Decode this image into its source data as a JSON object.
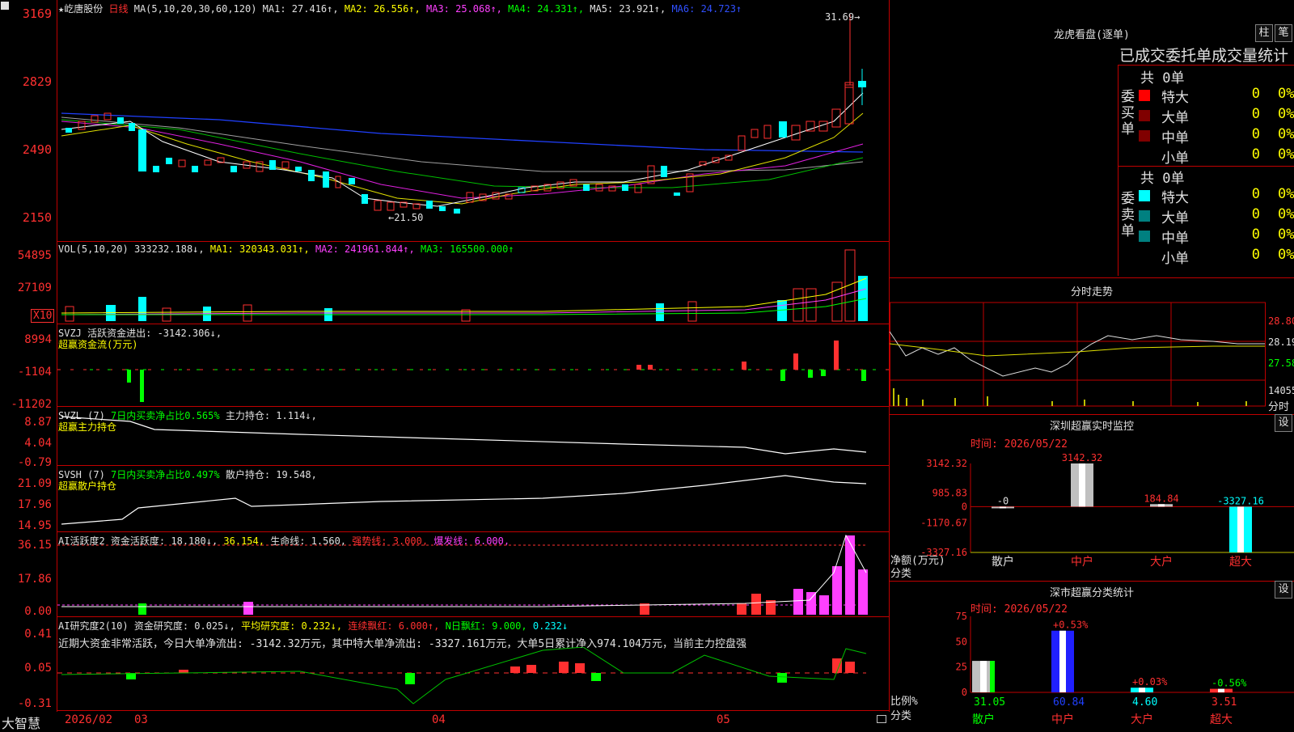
{
  "header": {
    "stock_name": "★屹唐股份",
    "period": "日线",
    "ma_label": "MA(5,10,20,30,60,120)",
    "ma1": "MA1: 27.416↑,",
    "ma2": "MA2: 26.556↑,",
    "ma3": "MA3: 25.068↑,",
    "ma4": "MA4: 24.331↑,",
    "ma5": "MA5: 23.921↑,",
    "ma6": "MA6: 24.723↑"
  },
  "price_axis": [
    "3169",
    "2829",
    "2490",
    "2150"
  ],
  "annotations": {
    "high": "31.69→",
    "low": "←21.50"
  },
  "vol": {
    "label": "VOL(5,10,20)",
    "value": "333232.188↓,",
    "ma1": "MA1: 320343.031↑,",
    "ma2": "MA2: 241961.844↑,",
    "ma3": "MA3: 165500.000↑",
    "axis": [
      "54895",
      "27109"
    ],
    "unit": "X10"
  },
  "svzj": {
    "label": "SVZJ  活跃资金进出: -3142.306↓,",
    "sub": "超赢资金流(万元)",
    "axis": [
      "8994",
      "-1104",
      "-11202"
    ]
  },
  "svzl": {
    "label": "SVZL (7)",
    "ratio": "7日内买卖净占比0.565%",
    "hold": "主力持仓: 1.114↓,",
    "sub": "超赢主力持仓",
    "axis": [
      "8.87",
      "4.04",
      "-0.79"
    ]
  },
  "svsh": {
    "label": "SVSH (7)",
    "ratio": "7日内买卖净占比0.497%",
    "hold": "散户持仓: 19.548,",
    "sub": "超赢散户持仓",
    "axis": [
      "21.09",
      "17.96",
      "14.95"
    ]
  },
  "ai1": {
    "label": "AI活跃度2",
    "v1": "资金活跃度: 18.180↓,",
    "v2": "36.154,",
    "v3": "生命线: 1.560,",
    "v4": "强势线: 3.000,",
    "v5": "爆发线: 6.000,",
    "axis": [
      "36.15",
      "17.86",
      "0.00"
    ]
  },
  "ai2": {
    "label": "AI研究度2(10)",
    "v1": "资金研究度: 0.025↓,",
    "v2": "平均研究度: 0.232↓,",
    "v3": "连续飘红: 6.000↑,",
    "v4": "N日飘红: 9.000,",
    "v5": "0.232↓",
    "comment": "近期大资金非常活跃，今日大单净流出: -3142.32万元，其中特大单净流出: -3327.161万元，大单5日累计净入974.104万元，当前主力控盘强",
    "axis": [
      "0.41",
      "0.05",
      "-0.31"
    ]
  },
  "bottom_axis": {
    "brand": "大智慧",
    "d1": "2026/02",
    "d2": "03",
    "d3": "04",
    "d4": "05"
  },
  "right": {
    "lhb_title": "龙虎看盘(逐单)",
    "btn_bar": "柱",
    "btn_pen": "笔",
    "stats_title": "已成交委托单成交量统计",
    "buy_side": "委买单",
    "sell_side": "委卖单",
    "buy_total": "共 0单",
    "sell_total": "共 0单",
    "buy_rows": [
      {
        "label": "特大",
        "value": "0",
        "pct": "0%",
        "color": "#ff0000"
      },
      {
        "label": "大单",
        "value": "0",
        "pct": "0%",
        "color": "#800000"
      },
      {
        "label": "中单",
        "value": "0",
        "pct": "0%",
        "color": "#800000"
      },
      {
        "label": "小单",
        "value": "0",
        "pct": "0%",
        "color": "#000000"
      }
    ],
    "sell_rows": [
      {
        "label": "特大",
        "value": "0",
        "pct": "0%",
        "color": "#00ffff"
      },
      {
        "label": "大单",
        "value": "0",
        "pct": "0%",
        "color": "#008080"
      },
      {
        "label": "中单",
        "value": "0",
        "pct": "0%",
        "color": "#008080"
      },
      {
        "label": "小单",
        "value": "0",
        "pct": "0%",
        "color": "#000000"
      }
    ],
    "fenshi_title": "分时走势",
    "fenshi_axis": [
      "28.80",
      "28.19",
      "27.58",
      "14055"
    ],
    "fenshi_unit": "分时",
    "sz_monitor_title": "深圳超赢实时监控",
    "sz_monitor_btn": "设",
    "sz_time": "时间: 2026/05/22",
    "net_axis": [
      "3142.32",
      "985.83",
      "0",
      "-1170.67",
      "-3327.16"
    ],
    "net_labels": [
      "-0",
      "3142.32",
      "184.84",
      "-3327.16"
    ],
    "net_unit": "净额(万元)",
    "net_cat": "分类",
    "categories": [
      "散户",
      "中户",
      "大户",
      "超大"
    ],
    "sz_class_title": "深市超赢分类统计",
    "sz_class_btn": "设",
    "class_time": "时间: 2026/05/22",
    "class_axis": [
      "75",
      "50",
      "25",
      "0"
    ],
    "class_top": [
      "+0.53%",
      "+0.03%",
      "-0.56%"
    ],
    "class_values": [
      "31.05",
      "60.84",
      "4.60",
      "3.51"
    ],
    "class_unit": "比例%",
    "class_cat": "分类"
  }
}
